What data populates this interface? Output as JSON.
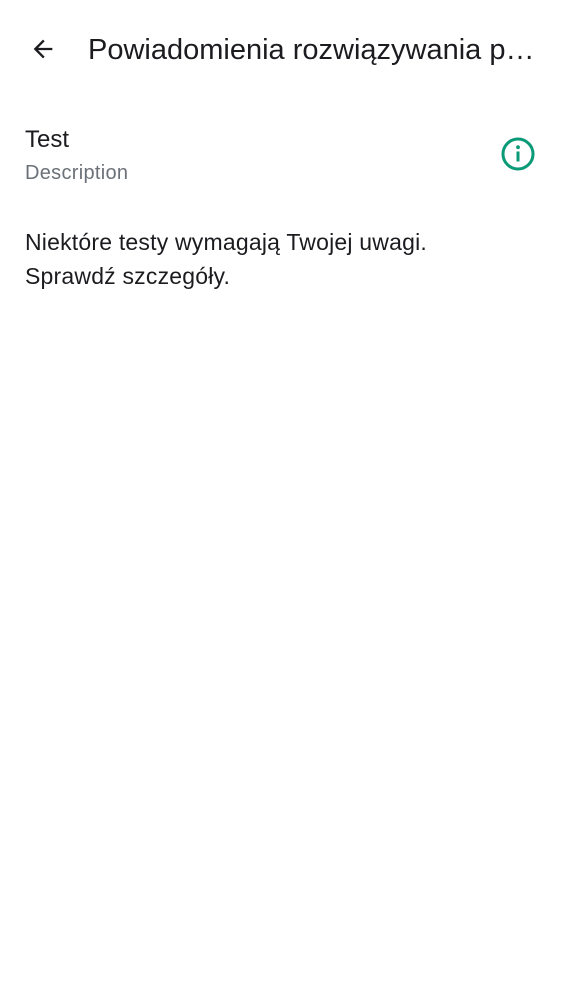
{
  "header": {
    "title": "Powiadomienia rozwiązywania problemów",
    "back_icon": "arrow-back-icon"
  },
  "test_item": {
    "title": "Test",
    "description": "Description",
    "info_icon": "info-icon",
    "info_icon_color": "#0a9a78"
  },
  "message": {
    "line1": "Niektóre testy wymagają Twojej uwagi.",
    "line2": "Sprawdź szczegóły."
  }
}
